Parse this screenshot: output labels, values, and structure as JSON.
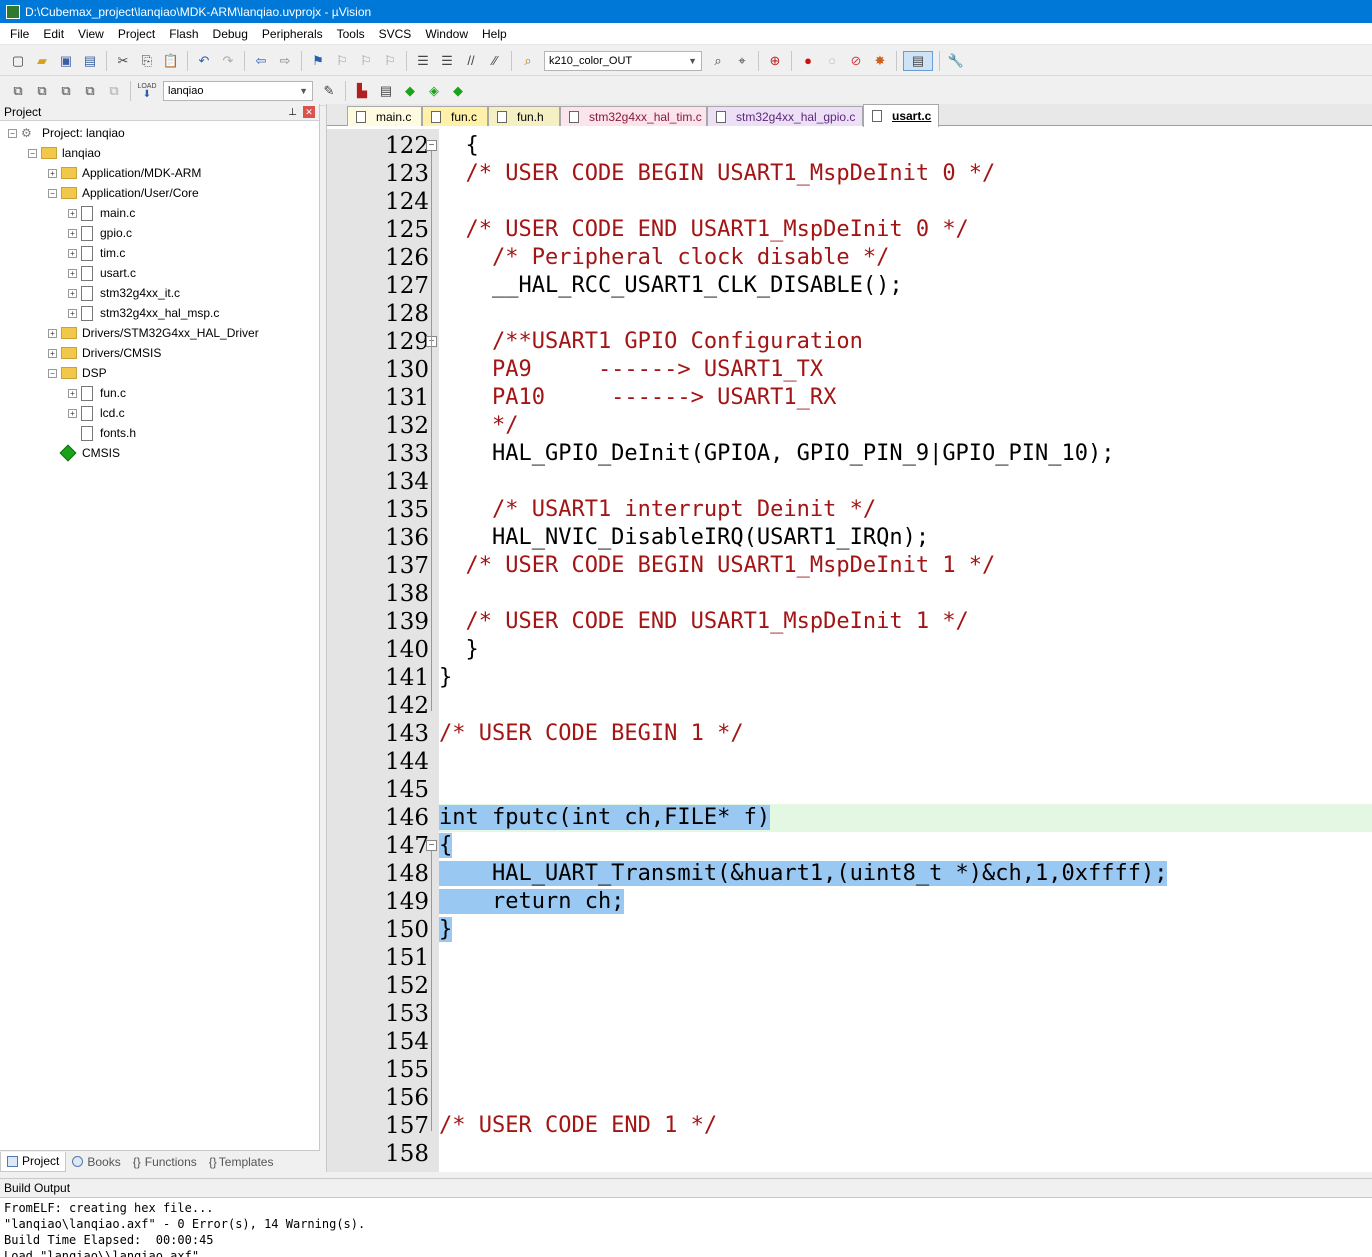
{
  "window": {
    "title": "D:\\Cubemax_project\\lanqiao\\MDK-ARM\\lanqiao.uvprojx - µVision"
  },
  "menu": [
    "File",
    "Edit",
    "View",
    "Project",
    "Flash",
    "Debug",
    "Peripherals",
    "Tools",
    "SVCS",
    "Window",
    "Help"
  ],
  "toolbar": {
    "config_value": "k210_color_OUT",
    "target_value": "lanqiao",
    "load_label": "LOAD"
  },
  "project_pane": {
    "title": "Project",
    "tree": [
      {
        "label": "Project: lanqiao"
      },
      {
        "label": "lanqiao"
      },
      {
        "label": "Application/MDK-ARM"
      },
      {
        "label": "Application/User/Core"
      },
      {
        "label": "main.c"
      },
      {
        "label": "gpio.c"
      },
      {
        "label": "tim.c"
      },
      {
        "label": "usart.c"
      },
      {
        "label": "stm32g4xx_it.c"
      },
      {
        "label": "stm32g4xx_hal_msp.c"
      },
      {
        "label": "Drivers/STM32G4xx_HAL_Driver"
      },
      {
        "label": "Drivers/CMSIS"
      },
      {
        "label": "DSP"
      },
      {
        "label": "fun.c"
      },
      {
        "label": "lcd.c"
      },
      {
        "label": "fonts.h"
      },
      {
        "label": "CMSIS"
      }
    ],
    "tabs": [
      "Project",
      "Books",
      "Functions",
      "Templates"
    ]
  },
  "editor": {
    "tabs": [
      {
        "label": "main.c",
        "color": "#fffbe1"
      },
      {
        "label": "fun.c",
        "color": "#fff2a8"
      },
      {
        "label": "fun.h",
        "color": "#f4f0c4"
      },
      {
        "label": "stm32g4xx_hal_tim.c",
        "color": "#fbe4ec"
      },
      {
        "label": "stm32g4xx_hal_gpio.c",
        "color": "#ede0f6"
      },
      {
        "label": "usart.c",
        "color": "#ffffff"
      }
    ],
    "active_tab": "usart.c",
    "line_numbers": [
      "122",
      "123",
      "124",
      "125",
      "126",
      "127",
      "128",
      "129",
      "130",
      "131",
      "132",
      "133",
      "134",
      "135",
      "136",
      "137",
      "138",
      "139",
      "140",
      "141",
      "142",
      "143",
      "144",
      "145",
      "146",
      "147",
      "148",
      "149",
      "150",
      "151",
      "152",
      "153",
      "154",
      "155",
      "156",
      "157",
      "158"
    ],
    "lines": [
      "  {",
      "  /* USER CODE BEGIN USART1_MspDeInit 0 */",
      "",
      "  /* USER CODE END USART1_MspDeInit 0 */",
      "    /* Peripheral clock disable */",
      "    __HAL_RCC_USART1_CLK_DISABLE();",
      "",
      "    /**USART1 GPIO Configuration",
      "    PA9     ------> USART1_TX",
      "    PA10     ------> USART1_RX",
      "    */",
      "    HAL_GPIO_DeInit(GPIOA, GPIO_PIN_9|GPIO_PIN_10);",
      "",
      "    /* USART1 interrupt Deinit */",
      "    HAL_NVIC_DisableIRQ(USART1_IRQn);",
      "  /* USER CODE BEGIN USART1_MspDeInit 1 */",
      "",
      "  /* USER CODE END USART1_MspDeInit 1 */",
      "  }",
      "}",
      "",
      "/* USER CODE BEGIN 1 */",
      "",
      "",
      "int fputc(int ch,FILE* f)",
      "{",
      "    HAL_UART_Transmit(&huart1,(uint8_t *)&ch,1,0xffff);",
      "    return ch;",
      "}",
      "",
      "",
      "",
      "",
      "",
      "",
      "/* USER CODE END 1 */",
      ""
    ]
  },
  "build_output": {
    "title": "Build Output",
    "lines": [
      "FromELF: creating hex file...",
      "\"lanqiao\\lanqiao.axf\" - 0 Error(s), 14 Warning(s).",
      "Build Time Elapsed:  00:00:45",
      "Load \"lanqiao\\\\lanqiao.axf\""
    ]
  }
}
